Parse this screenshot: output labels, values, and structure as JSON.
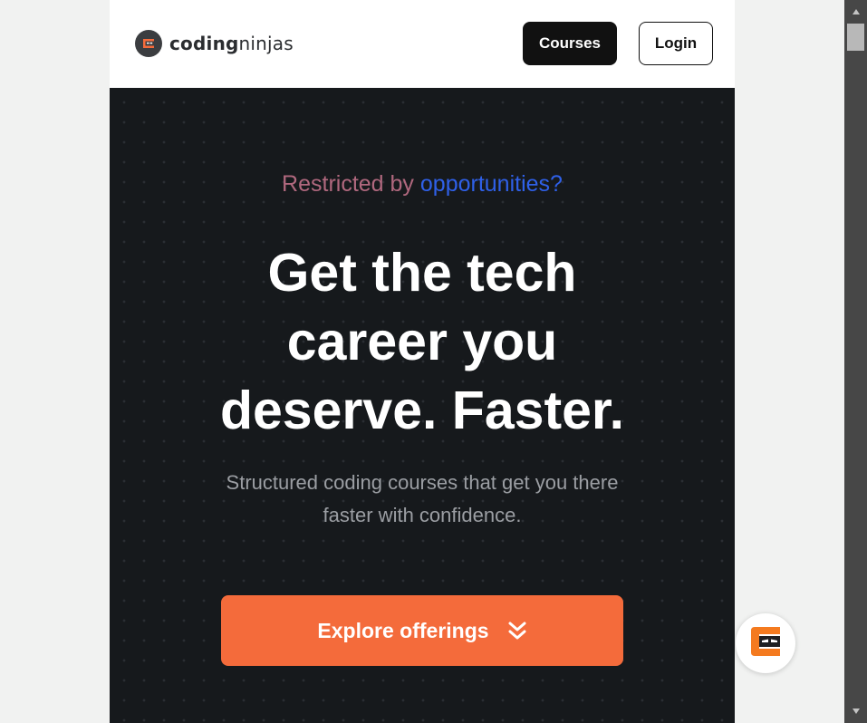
{
  "header": {
    "logo": {
      "bold": "coding",
      "light": "ninjas"
    },
    "courses_label": "Courses",
    "login_label": "Login"
  },
  "hero": {
    "tagline_part1": "Restricted by",
    "tagline_part2": "opportunities?",
    "headline_lines": [
      "Get the tech",
      "career you",
      "deserve. Faster."
    ],
    "subtitle_lines": [
      "Structured coding courses that get you there",
      "faster with confidence."
    ],
    "cta_label": "Explore offerings"
  },
  "colors": {
    "brand_orange": "#f46b3b",
    "hero_bg": "#16191c",
    "tagline_pink": "#b0687e",
    "tagline_blue": "#2f60e8"
  },
  "icons": {
    "logo": "coding-ninjas-logo-icon",
    "cta": "double-chevron-down-icon",
    "fab": "ninja-logo-icon"
  }
}
